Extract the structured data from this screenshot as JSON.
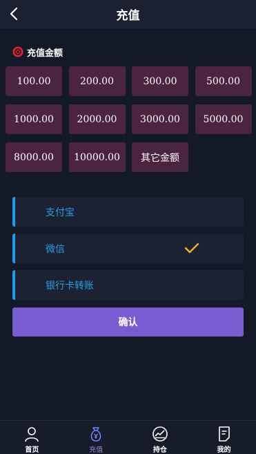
{
  "header": {
    "title": "充值"
  },
  "section": {
    "title": "充值金额"
  },
  "amounts": [
    "100.00",
    "200.00",
    "300.00",
    "500.00",
    "1000.00",
    "2000.00",
    "3000.00",
    "5000.00",
    "8000.00",
    "10000.00",
    "其它金额"
  ],
  "methods": [
    {
      "label": "支付宝",
      "selected": false
    },
    {
      "label": "微信",
      "selected": true
    },
    {
      "label": "银行卡转账",
      "selected": false
    }
  ],
  "confirm": {
    "label": "确认"
  },
  "tabbar": {
    "items": [
      {
        "label": "首页",
        "icon": "person-icon",
        "active": false
      },
      {
        "label": "充值",
        "icon": "money-bag-icon",
        "active": true
      },
      {
        "label": "持仓",
        "icon": "chart-icon",
        "active": false
      },
      {
        "label": "我的",
        "icon": "document-icon",
        "active": false
      }
    ]
  },
  "colors": {
    "background": "#131926",
    "amount_button": "#4a2440",
    "method_accent": "#1a9df0",
    "confirm_button": "#7a5cd2",
    "check": "#f0b429",
    "active_tab": "#9b86e8"
  }
}
